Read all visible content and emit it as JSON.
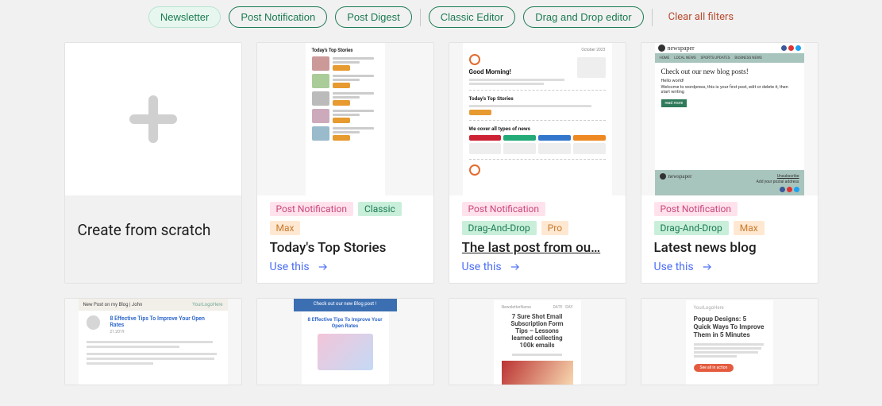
{
  "filters": {
    "groups": [
      [
        "Newsletter",
        "Post Notification",
        "Post Digest"
      ],
      [
        "Classic Editor",
        "Drag and Drop editor"
      ]
    ],
    "active": "Newsletter",
    "clear_label": "Clear all filters"
  },
  "scratch_card": {
    "title": "Create from scratch"
  },
  "use_label": "Use this",
  "templates": [
    {
      "id": "tpl-top-stories",
      "title": "Today's Top Stories",
      "tags": [
        {
          "text": "Post Notification",
          "cls": "pink"
        },
        {
          "text": "Classic",
          "cls": "green"
        },
        {
          "text": "Max",
          "cls": "orange"
        }
      ],
      "underline": false
    },
    {
      "id": "tpl-last-post",
      "title": "The last post from ou…",
      "tags": [
        {
          "text": "Post Notification",
          "cls": "pink"
        },
        {
          "text": "Drag-And-Drop",
          "cls": "green"
        },
        {
          "text": "Pro",
          "cls": "orange"
        }
      ],
      "underline": true
    },
    {
      "id": "tpl-latest-news",
      "title": "Latest news blog",
      "tags": [
        {
          "text": "Post Notification",
          "cls": "pink"
        },
        {
          "text": "Drag-And-Drop",
          "cls": "green"
        },
        {
          "text": "Max",
          "cls": "orange"
        }
      ],
      "underline": false
    }
  ],
  "preview_text": {
    "tpl1": {
      "heading": "Today's Top Stories"
    },
    "tpl2": {
      "date": "October 2023",
      "greeting": "Good Morning!",
      "section1": "Today's Top Stories",
      "section2": "We cover all types of news"
    },
    "tpl3": {
      "brand": "newspaper",
      "menu": [
        "HOME",
        "LOCAL NEWS",
        "SPORTS UPDATES",
        "BUSINESS NEWS"
      ],
      "headline": "Check out our new blog posts!",
      "sub1": "Hello world!",
      "sub2": "Welcome to wordpress, this is your first post, edit or delete it, then start writing",
      "btn": "read more",
      "foot_link": "Unsubscribe",
      "foot_addr": "Add your postal address"
    },
    "row2": {
      "a": {
        "bar_left": "New Post on my Blog | John",
        "bar_right": "YourLogoHere",
        "title": "8 Effective Tips To Improve Your Open Rates"
      },
      "b": {
        "bar": "Check out our new Blog post !",
        "title": "8 Effective Tips To Improve Your Open Rates"
      },
      "c": {
        "title": "7 Sure Shot Email Subscription Form Tips – Lessons learned collecting 100k emails"
      },
      "d": {
        "logo": "YourLogoHere",
        "title": "Popup Designs: 5 Quick Ways To Improve Them in 5 Minutes",
        "btn": "See all in action"
      }
    }
  }
}
